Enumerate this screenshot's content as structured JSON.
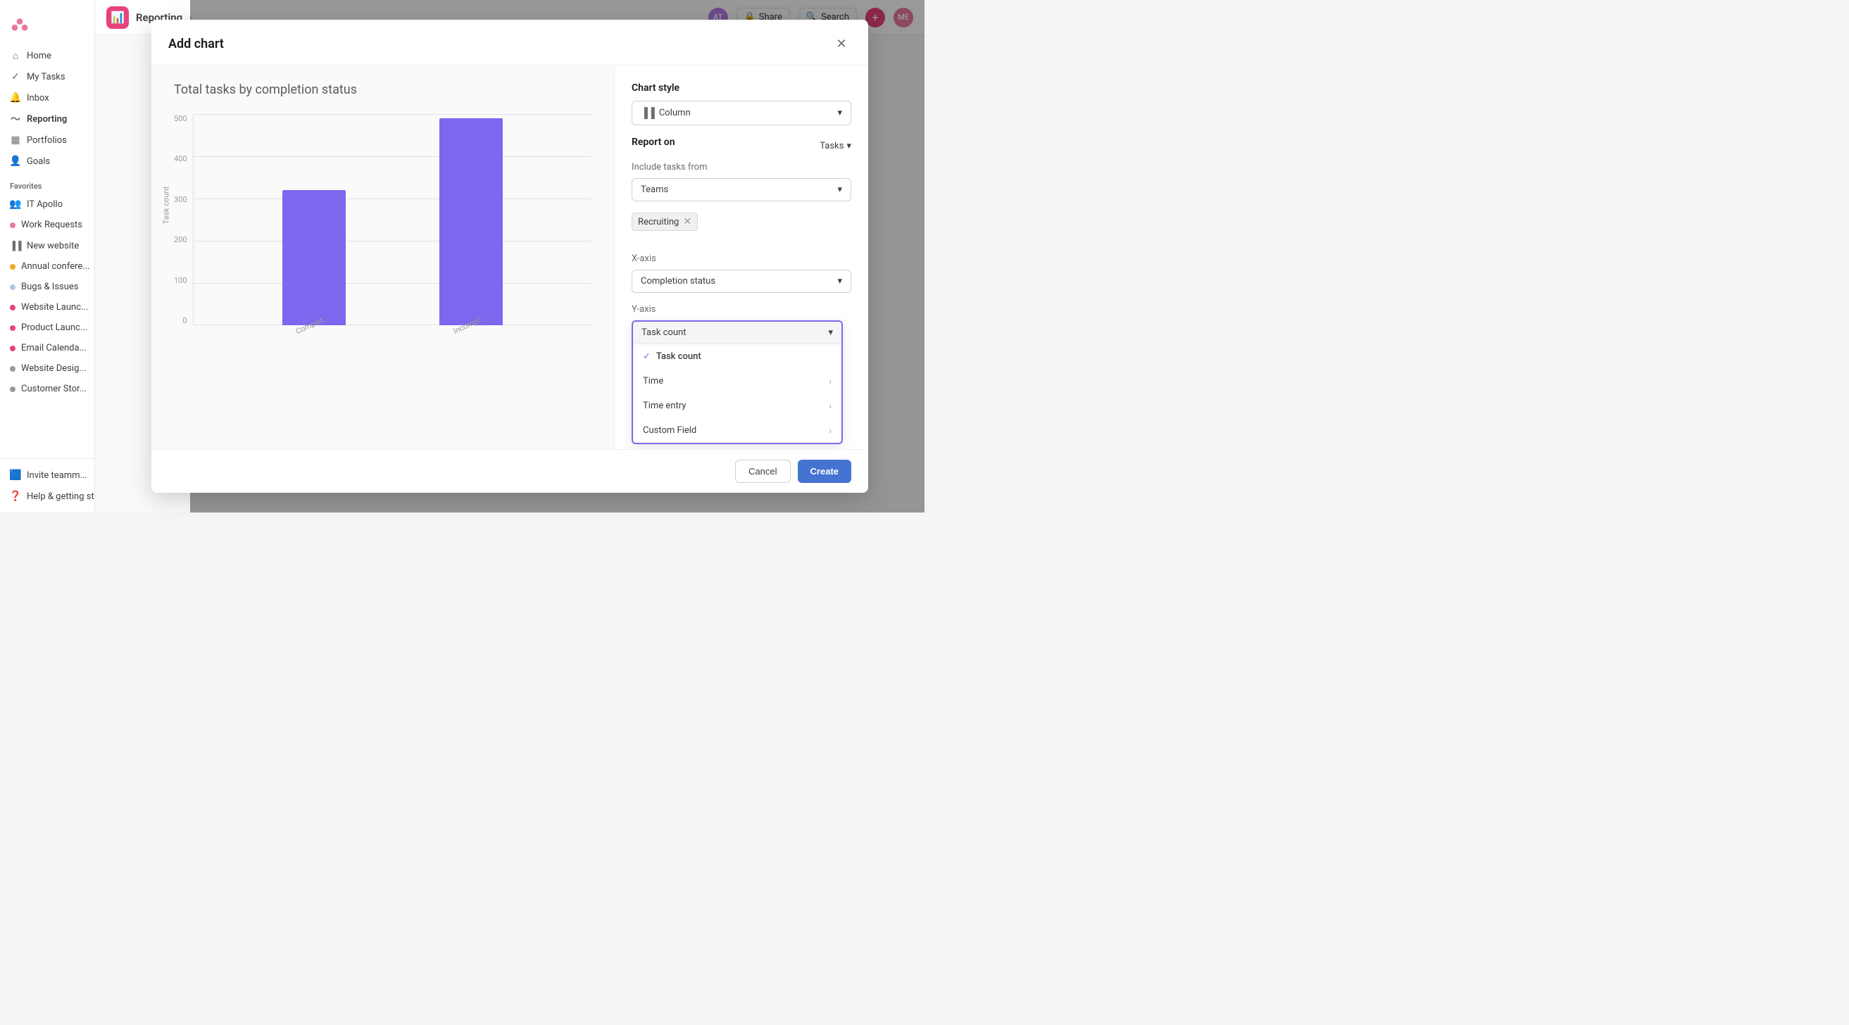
{
  "app": {
    "name": "Asana"
  },
  "sidebar": {
    "nav_items": [
      {
        "id": "home",
        "label": "Home",
        "icon": "home"
      },
      {
        "id": "my-tasks",
        "label": "My Tasks",
        "icon": "check-circle"
      },
      {
        "id": "inbox",
        "label": "Inbox",
        "icon": "bell"
      },
      {
        "id": "reporting",
        "label": "Reporting",
        "icon": "chart-line",
        "active": true
      },
      {
        "id": "portfolios",
        "label": "Portfolios",
        "icon": "briefcase"
      },
      {
        "id": "goals",
        "label": "Goals",
        "icon": "person"
      }
    ],
    "section_favorites": "Favorites",
    "favorites": [
      {
        "id": "it-apollo",
        "label": "IT Apollo",
        "color": "#6d6d6d",
        "icon": "person"
      },
      {
        "id": "work-requests",
        "label": "Work Requests",
        "color": "#e879a0"
      },
      {
        "id": "new-website",
        "label": "New website",
        "color": "#9b9b9b",
        "icon": "chart-bar"
      },
      {
        "id": "annual-conf",
        "label": "Annual confere...",
        "color": "#f5a623"
      },
      {
        "id": "bugs-issues",
        "label": "Bugs & Issues",
        "color": "#b4c6e0"
      },
      {
        "id": "website-launch",
        "label": "Website Launc...",
        "color": "#e8427c"
      },
      {
        "id": "product-launch",
        "label": "Product Launc...",
        "color": "#e8427c"
      },
      {
        "id": "email-calendar",
        "label": "Email Calenda...",
        "color": "#e8427c"
      },
      {
        "id": "website-design",
        "label": "Website Desig...",
        "color": "#9b9b9b"
      },
      {
        "id": "customer-story",
        "label": "Customer Stor...",
        "color": "#9b9b9b"
      }
    ],
    "invite_label": "Invite teamm...",
    "help_label": "Help & getting started"
  },
  "topbar": {
    "page_icon": "📊",
    "title": "Reporting",
    "breadcrumb_arrow": "›",
    "share_label": "Share",
    "search_label": "Search"
  },
  "modal": {
    "title": "Add chart",
    "chart_title": "Total tasks by completion status",
    "close_icon": "✕",
    "chart_style_label": "Chart style",
    "chart_style_value": "Column",
    "chart_style_icon": "▐▐",
    "report_on_label": "Report on",
    "report_on_value": "Tasks",
    "include_tasks_label": "Include tasks from",
    "include_tasks_value": "Teams",
    "tag_label": "Recruiting",
    "xaxis_label": "X-axis",
    "xaxis_value": "Completion status",
    "yaxis_label": "Y-axis",
    "yaxis_value": "Task count",
    "dropdown_items": [
      {
        "id": "task-count",
        "label": "Task count",
        "selected": true,
        "has_submenu": false
      },
      {
        "id": "time",
        "label": "Time",
        "selected": false,
        "has_submenu": true
      },
      {
        "id": "time-entry",
        "label": "Time entry",
        "selected": false,
        "has_submenu": true
      },
      {
        "id": "custom-field",
        "label": "Custom Field",
        "selected": false,
        "has_submenu": true
      }
    ],
    "cancel_label": "Cancel",
    "create_label": "Create"
  },
  "chart": {
    "y_labels": [
      "500",
      "400",
      "300",
      "200",
      "100",
      "0"
    ],
    "y_axis_title": "Task count",
    "bars": [
      {
        "label": "Complet...",
        "height_pct": 64,
        "value": 330
      },
      {
        "label": "Incompl...",
        "height_pct": 100,
        "value": 520
      }
    ]
  }
}
